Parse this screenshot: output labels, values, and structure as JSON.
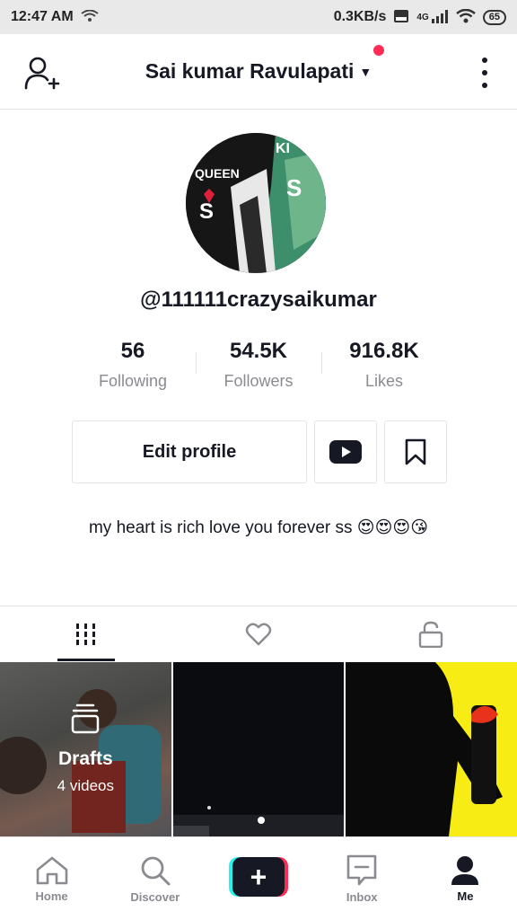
{
  "status_bar": {
    "time": "12:47 AM",
    "network_speed": "0.3KB/s",
    "network_type": "4G",
    "battery": "65"
  },
  "header": {
    "title": "Sai kumar Ravulapati",
    "has_notification_dot": true
  },
  "profile": {
    "handle": "@111111crazysaikumar",
    "stats": [
      {
        "value": "56",
        "label": "Following"
      },
      {
        "value": "54.5K",
        "label": "Followers"
      },
      {
        "value": "916.8K",
        "label": "Likes"
      }
    ],
    "edit_profile_label": "Edit profile",
    "bio": "my heart is rich love you forever ss 😍😍😍😘"
  },
  "tabs": [
    {
      "icon": "grid-icon",
      "active": true
    },
    {
      "icon": "heart-icon",
      "active": false
    },
    {
      "icon": "lock-icon",
      "active": false
    }
  ],
  "grid": {
    "drafts_title": "Drafts",
    "drafts_count": "4 videos"
  },
  "bottom_nav": [
    {
      "label": "Home",
      "icon": "home-icon"
    },
    {
      "label": "Discover",
      "icon": "search-icon"
    },
    {
      "label": "",
      "icon": "plus-icon"
    },
    {
      "label": "Inbox",
      "icon": "inbox-icon"
    },
    {
      "label": "Me",
      "icon": "person-icon",
      "active": true
    }
  ],
  "colors": {
    "accent_red": "#fe2c55",
    "accent_cyan": "#25f4ee",
    "text_primary": "#161823",
    "text_secondary": "#8a8b91"
  }
}
